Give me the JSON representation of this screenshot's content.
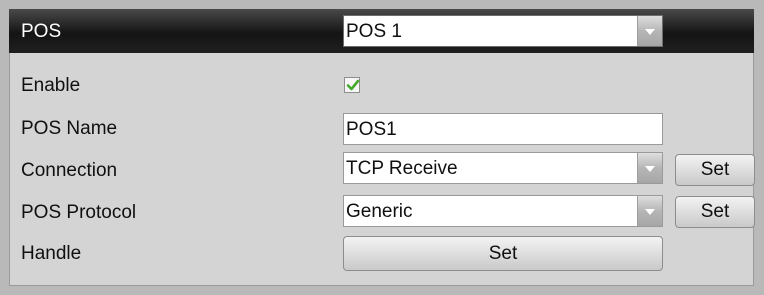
{
  "header": {
    "title": "POS",
    "pos_select": {
      "value": "POS 1"
    }
  },
  "form": {
    "enable": {
      "label": "Enable",
      "checked": true
    },
    "pos_name": {
      "label": "POS Name",
      "value": "POS1"
    },
    "connection": {
      "label": "Connection",
      "value": "TCP Receive",
      "set_label": "Set"
    },
    "pos_protocol": {
      "label": "POS Protocol",
      "value": "Generic",
      "set_label": "Set"
    },
    "handle": {
      "label": "Handle",
      "set_label": "Set"
    }
  },
  "icons": {
    "dropdown": "chevron-down-icon",
    "check": "checkmark-icon"
  },
  "colors": {
    "header_bg": "#141414",
    "panel_bg": "#d4d4d4",
    "check": "#46a92d"
  }
}
